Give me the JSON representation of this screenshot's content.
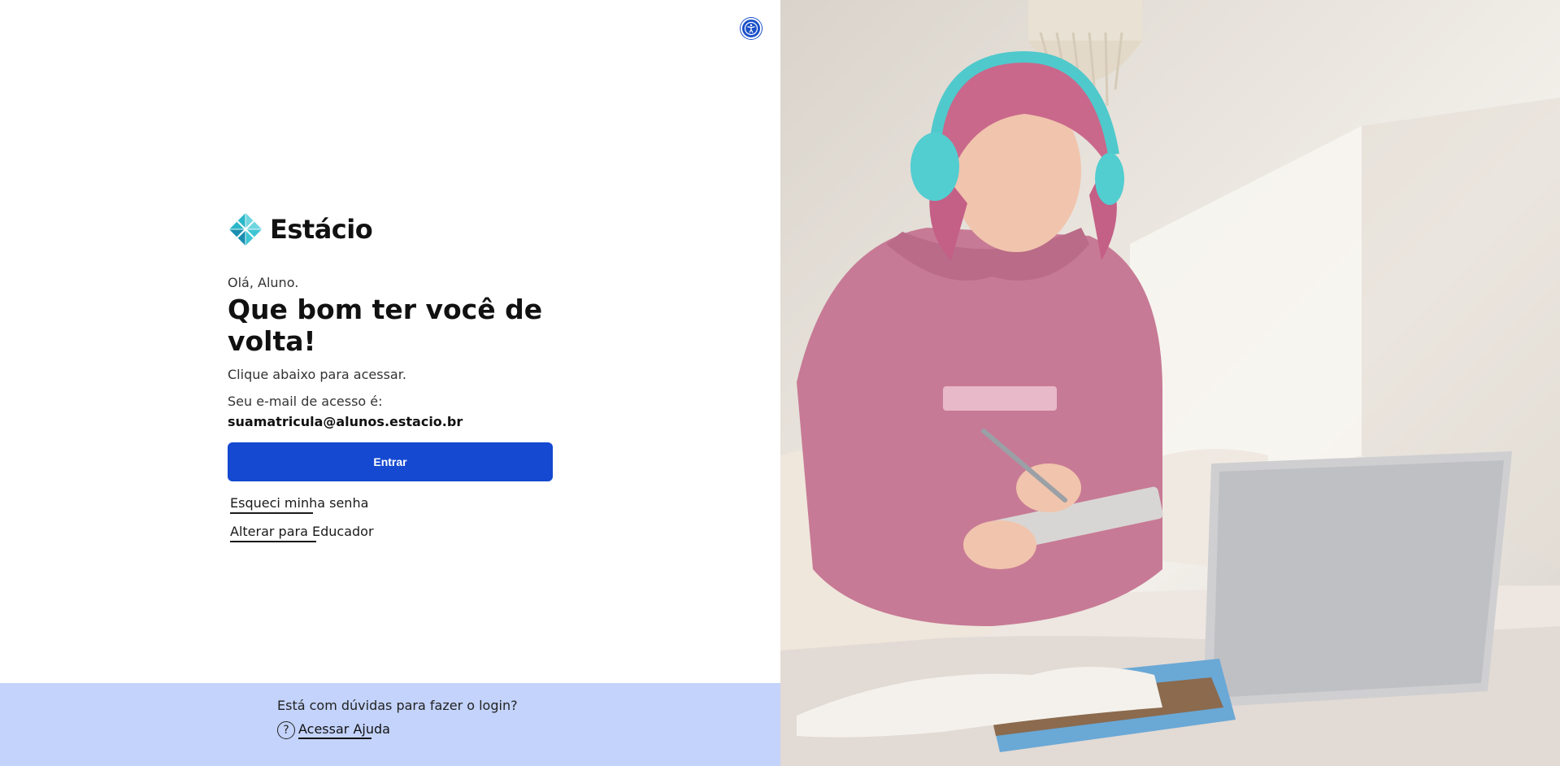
{
  "brand": {
    "name": "Estácio"
  },
  "accessibility": {
    "icon": "accessibility-icon"
  },
  "login": {
    "greeting": "Olá, Aluno.",
    "headline": "Que bom ter você de volta!",
    "instruction": "Clique abaixo para acessar.",
    "email_label": "Seu e-mail de acesso é:",
    "email_value": "suamatricula@alunos.estacio.br",
    "enter_label": "Entrar",
    "forgot_label": "Esqueci minha senha",
    "switch_label": "Alterar para Educador"
  },
  "help": {
    "question": "Está com dúvidas para fazer o login?",
    "link_label": "Acessar Ajuda",
    "icon_glyph": "?"
  },
  "colors": {
    "primary": "#1549d1",
    "help_bg": "#c3d3fb",
    "logo_teal": "#2bb7c9"
  }
}
